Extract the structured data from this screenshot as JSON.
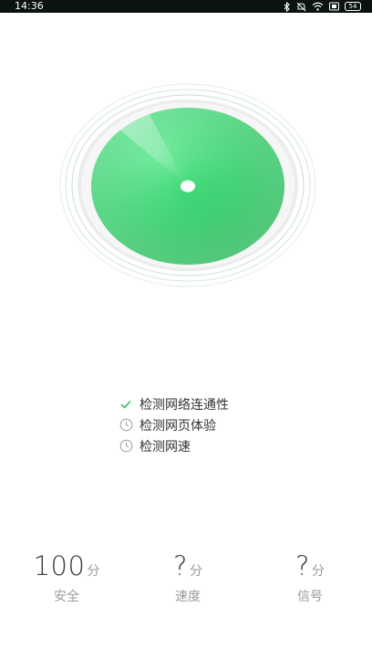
{
  "status_bar": {
    "time": "14:36",
    "battery": "54",
    "icons": [
      "bluetooth-icon",
      "mute-icon",
      "wifi-icon",
      "screen-icon",
      "battery-icon"
    ]
  },
  "radar": {
    "colors": {
      "fill_light": "#46e07c",
      "fill_dark": "#18b44e",
      "ring": "#b8d8c2",
      "halo": "#e9ece9"
    }
  },
  "checklist": [
    {
      "label": "检测网络连通性",
      "state": "done",
      "icon": "check-icon"
    },
    {
      "label": "检测网页体验",
      "state": "pending",
      "icon": "clock-icon"
    },
    {
      "label": "检测网速",
      "state": "pending",
      "icon": "clock-icon"
    }
  ],
  "scores": [
    {
      "value": "100",
      "unit": "分",
      "label": "安全"
    },
    {
      "value": "?",
      "unit": "分",
      "label": "速度"
    },
    {
      "value": "?",
      "unit": "分",
      "label": "信号"
    }
  ],
  "colors": {
    "accent": "#23c35d",
    "muted": "#9a9a9a",
    "text": "#333333"
  }
}
